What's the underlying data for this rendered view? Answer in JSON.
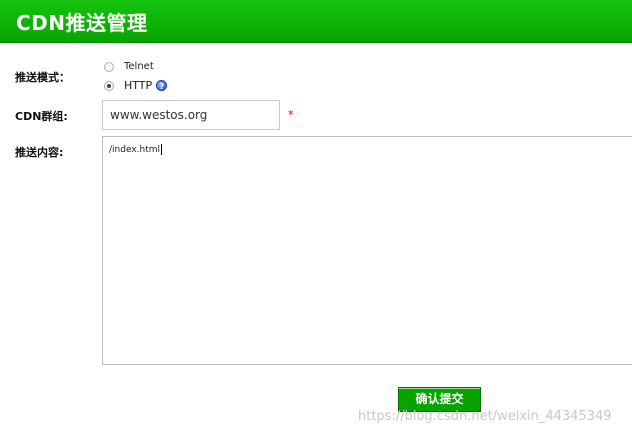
{
  "header": {
    "title": "CDN推送管理"
  },
  "form": {
    "mode_label": "推送模式：",
    "modes": [
      {
        "label": "Telnet",
        "checked": false
      },
      {
        "label": "HTTP",
        "checked": true
      }
    ],
    "help_icon": "question-icon",
    "group_label": "CDN群组:",
    "group_value": "www.westos.org",
    "required_mark": "*",
    "content_label": "推送内容:",
    "content_value": "/index.html",
    "submit_label": "确认提交"
  },
  "watermark": "https://blog.csdn.net/weixin_44345349",
  "colors": {
    "header_green": "#0aa800",
    "button_green": "#07a300",
    "required_red": "#e00000"
  }
}
